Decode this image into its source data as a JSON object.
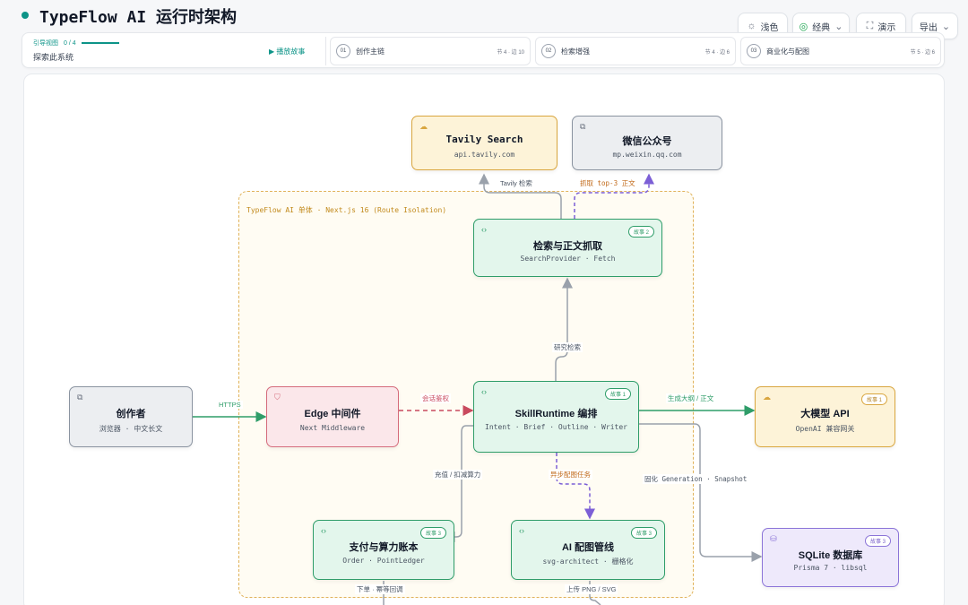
{
  "header": {
    "title": "TypeFlow AI 运行时架构"
  },
  "toolbar": {
    "theme_label": "浅色",
    "style_label": "经典",
    "present_label": "演示",
    "export_label": "导出"
  },
  "guide": {
    "label": "引导视图",
    "progress": "0 / 4",
    "subtitle": "探索此系统",
    "replay_label": "播放故事"
  },
  "steps": [
    {
      "num": "01",
      "label": "创作主链",
      "meta": "节 4 · 边 10"
    },
    {
      "num": "02",
      "label": "检索增强",
      "meta": "节 4 · 边 6"
    },
    {
      "num": "03",
      "label": "商业化与配图",
      "meta": "节 5 · 边 6"
    }
  ],
  "boundary": {
    "label": "TypeFlow AI 单体 · Next.js 16 (Route Isolation)"
  },
  "nodes": {
    "tavily": {
      "title": "Tavily Search",
      "sub": "api.tavily.com"
    },
    "wechat": {
      "title": "微信公众号",
      "sub": "mp.weixin.qq.com"
    },
    "retrieval": {
      "title": "检索与正文抓取",
      "sub": "SearchProvider · Fetch",
      "badge": "故事 2"
    },
    "author": {
      "title": "创作者",
      "sub": "浏览器 · 中文长文"
    },
    "edge": {
      "title": "Edge 中间件",
      "sub": "Next Middleware"
    },
    "skill": {
      "title": "SkillRuntime 编排",
      "sub": "Intent · Brief · Outline · Writer",
      "badge": "故事 1"
    },
    "llm": {
      "title": "大模型 API",
      "sub": "OpenAI 兼容网关",
      "badge": "故事 1"
    },
    "payment": {
      "title": "支付与算力账本",
      "sub": "Order · PointLedger",
      "badge": "故事 3"
    },
    "pipeline": {
      "title": "AI 配图管线",
      "sub": "svg-architect · 栅格化",
      "badge": "故事 3"
    },
    "sqlite": {
      "title": "SQLite 数据库",
      "sub": "Prisma 7 · libsql",
      "badge": "故事 3"
    }
  },
  "edge_labels": {
    "tavily_search": "Tavily 检索",
    "fetch_top3": "抓取 top-3 正文",
    "research": "研究检索",
    "https": "HTTPS",
    "session": "会话鉴权",
    "generate": "生成大纲 / 正文",
    "recharge": "充值 / 扣减算力",
    "async_job": "异步配图任务",
    "persist": "固化 Generation · Snapshot",
    "order": "下单 · 幂等回调",
    "upload": "上传 PNG / SVG"
  },
  "colors": {
    "accent": "#0d9488",
    "green_edge": "#2f9d69",
    "red_edge": "#c94a5e",
    "purple_edge": "#7c5fd6",
    "gray_edge": "#9aa1ab",
    "amber_label": "#c26b1c"
  }
}
